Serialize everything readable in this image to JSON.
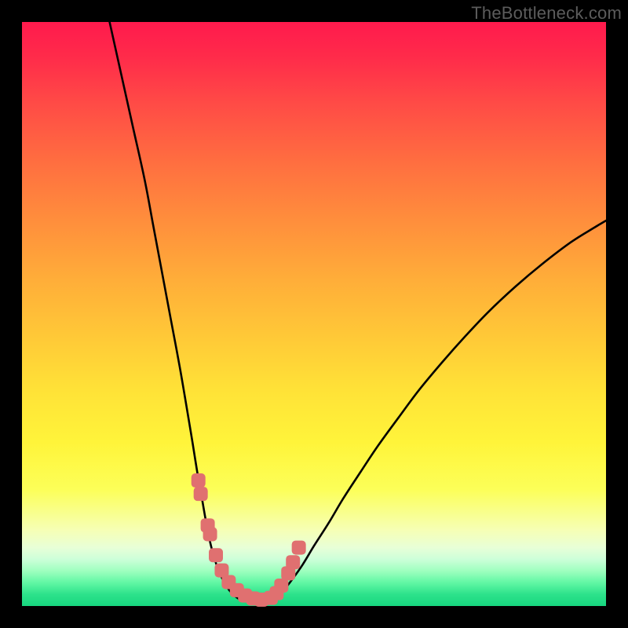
{
  "watermark": "TheBottleneck.com",
  "chart_data": {
    "type": "line",
    "title": "",
    "xlabel": "",
    "ylabel": "",
    "xlim": [
      0,
      100
    ],
    "ylim": [
      0,
      100
    ],
    "grid": false,
    "series": [
      {
        "name": "left-curve",
        "x": [
          15,
          17,
          19,
          21,
          22.5,
          24,
          25.5,
          27,
          28.2,
          29.2,
          30,
          30.8,
          31.5,
          32.2,
          33,
          34,
          35,
          36,
          37
        ],
        "values": [
          100,
          91,
          82,
          73,
          65,
          57,
          49,
          41,
          34,
          28,
          23,
          18.5,
          14.5,
          11,
          8,
          5.3,
          3.4,
          2.1,
          1.3
        ]
      },
      {
        "name": "right-curve",
        "x": [
          43,
          44.5,
          46,
          48,
          50,
          52.5,
          55,
          58,
          61,
          64.5,
          68,
          72,
          76,
          80,
          84.5,
          89,
          94,
          98,
          100
        ],
        "values": [
          1.3,
          2.4,
          4.2,
          7,
          10.3,
          14.2,
          18.4,
          23,
          27.5,
          32.3,
          37,
          41.8,
          46.3,
          50.5,
          54.7,
          58.5,
          62.3,
          64.8,
          66
        ]
      },
      {
        "name": "pink-dots-left",
        "x": [
          30.2,
          30.6,
          31.8,
          32.2,
          33.2,
          34.2,
          35.4,
          36.8,
          38.2,
          39.6,
          41
        ],
        "values": [
          21.5,
          19.2,
          13.8,
          12.3,
          8.7,
          6.1,
          4.1,
          2.7,
          1.8,
          1.3,
          1.1
        ]
      },
      {
        "name": "pink-dots-right",
        "x": [
          42.6,
          43.6,
          44.4,
          45.6,
          46.4,
          47.4
        ],
        "values": [
          1.4,
          2.2,
          3.5,
          5.6,
          7.5,
          10
        ]
      }
    ],
    "colors": {
      "curve": "#000000",
      "dots": "#e07070",
      "gradient_top": "#ff1a4d",
      "gradient_mid": "#ffe237",
      "gradient_bottom": "#17d67f"
    },
    "dot_radius_px": 9
  }
}
